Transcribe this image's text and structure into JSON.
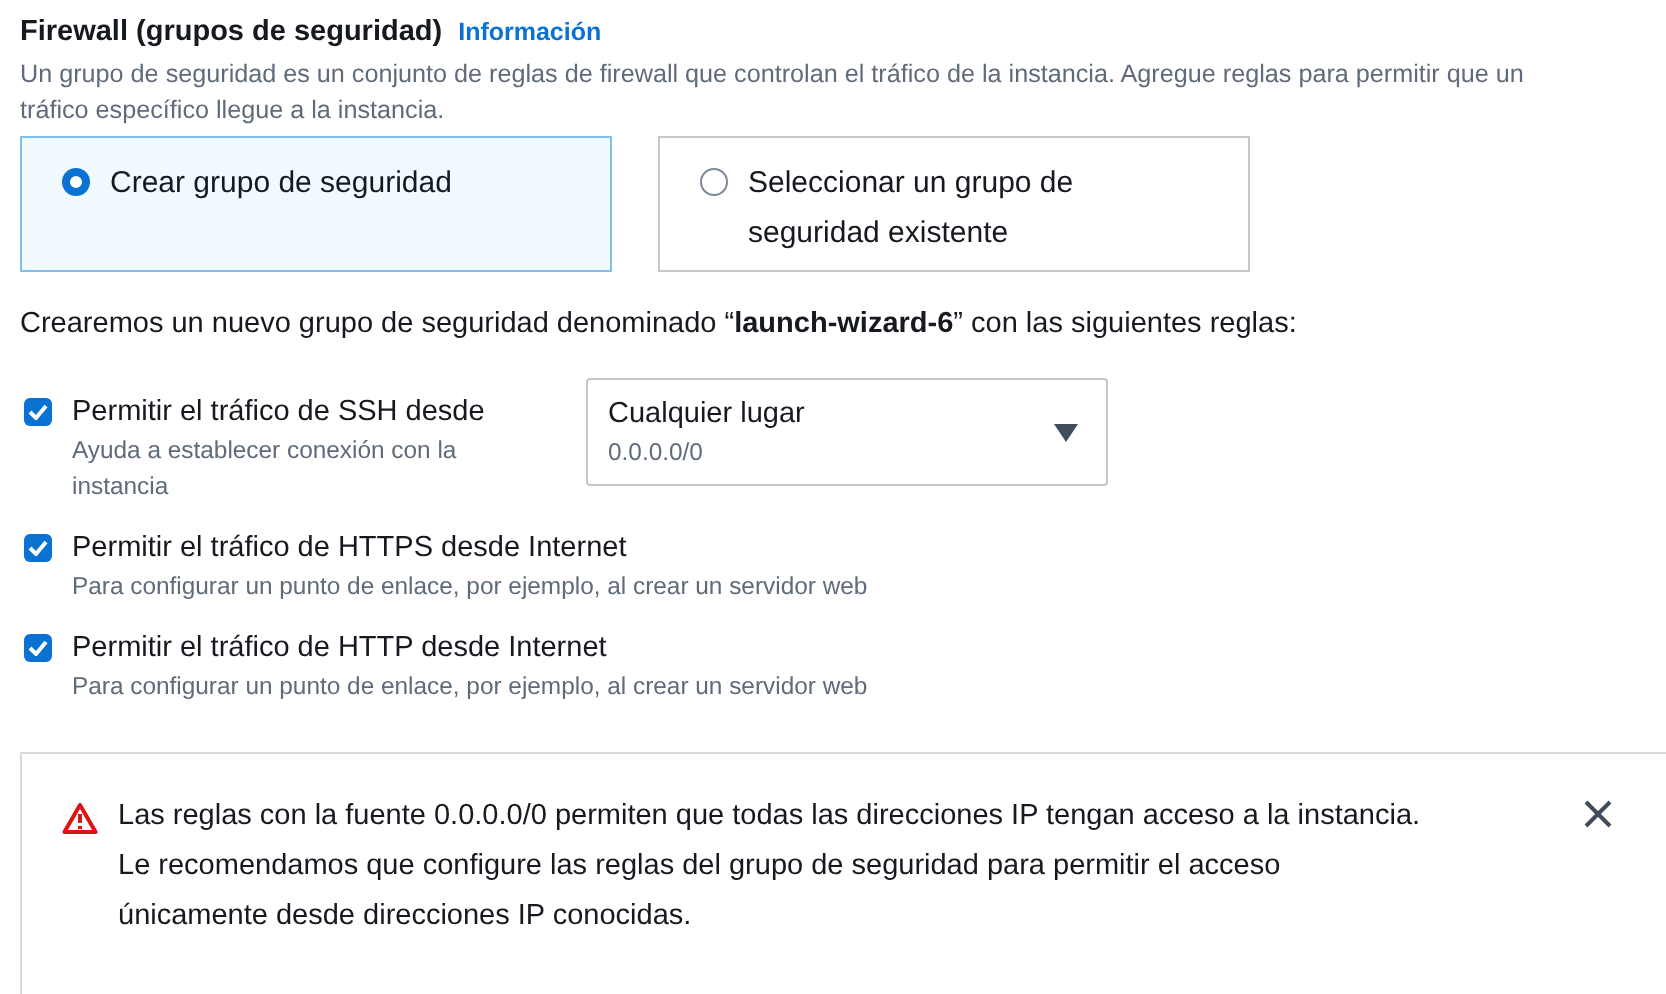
{
  "section": {
    "title": "Firewall (grupos de seguridad)",
    "info_link": "Información",
    "description": "Un grupo de seguridad es un conjunto de reglas de firewall que controlan el tráfico de la instancia. Agregue reglas para permitir que un\ntráfico específico llegue a la instancia."
  },
  "options": [
    {
      "label": "Crear grupo de seguridad",
      "selected": true
    },
    {
      "label": "Seleccionar un grupo de\nseguridad existente",
      "selected": false
    }
  ],
  "summary": "Crearemos un nuevo grupo de seguridad denominado “**launch-wizard-6**” con las siguientes reglas:",
  "rules": [
    {
      "label": "Permitir el tráfico de SSH desde",
      "hint": "Ayuda a establecer conexión con la\ninstancia",
      "checked": true,
      "source": {
        "value": "Cualquier lugar",
        "detail": "0.0.0.0/0"
      }
    },
    {
      "label": "Permitir el tráfico de HTTPS desde Internet",
      "hint": "Para configurar un punto de enlace, por ejemplo, al crear un servidor web",
      "checked": true
    },
    {
      "label": "Permitir el tráfico de HTTP desde Internet",
      "hint": "Para configurar un punto de enlace, por ejemplo, al crear un servidor web",
      "checked": true
    }
  ],
  "alert": {
    "message": "Las reglas con la fuente 0.0.0.0/0 permiten que todas las direcciones IP tengan acceso a la instancia.\nLe recomendamos que configure las reglas del grupo de seguridad para permitir el acceso\núnicamente desde direcciones IP conocidas."
  }
}
